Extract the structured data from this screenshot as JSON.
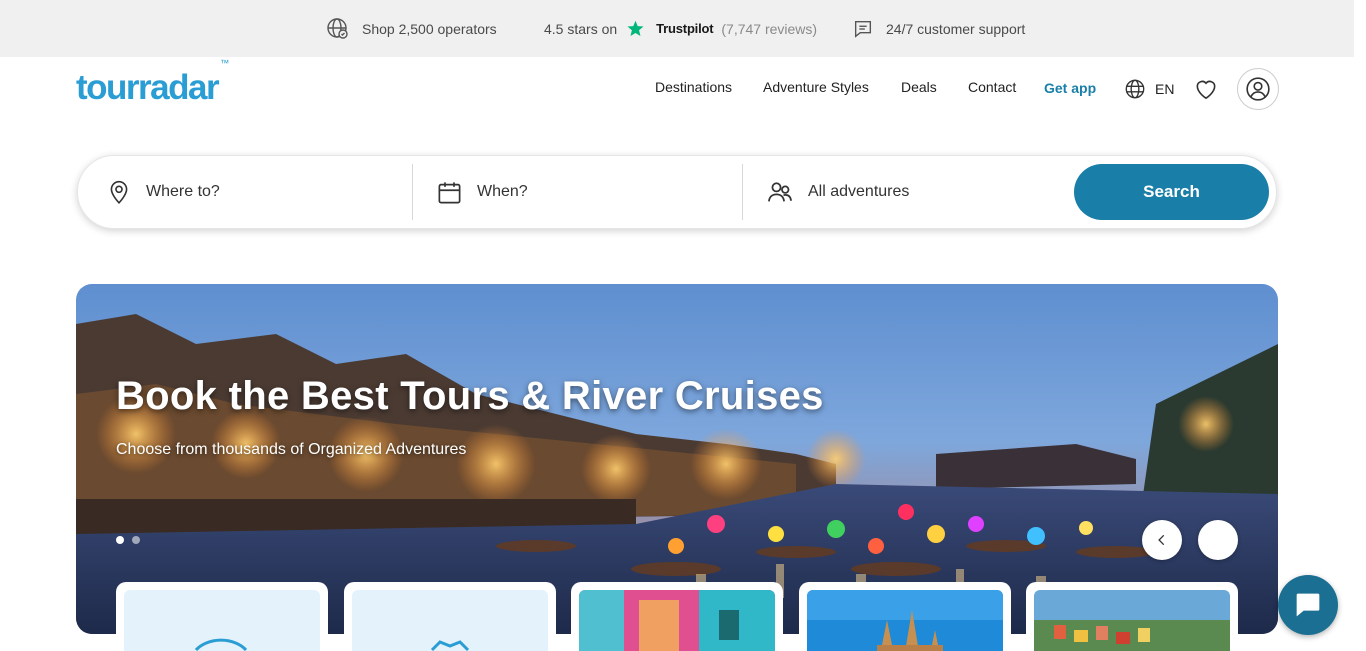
{
  "topbar": {
    "operators": "Shop 2,500 operators",
    "rating_prefix": "4.5 stars on",
    "trustpilot": "Trustpilot",
    "reviews": "(7,747 reviews)",
    "support": "24/7 customer support"
  },
  "header": {
    "logo": "tourradar",
    "logo_tm": "™",
    "nav": [
      "Destinations",
      "Adventure Styles",
      "Deals",
      "Contact"
    ],
    "get_app": "Get app",
    "language": "EN"
  },
  "search": {
    "where_placeholder": "Where to?",
    "when_placeholder": "When?",
    "adventure_value": "All adventures",
    "button": "Search"
  },
  "hero": {
    "title": "Book the Best Tours & River Cruises",
    "subtitle": "Choose from thousands of Organized Adventures",
    "active_slide": 1,
    "total_slides": 2
  },
  "icons": {
    "operators": "globe-badge-icon",
    "rating": "trustpilot-star-icon",
    "support": "chat-bubble-icon",
    "language": "globe-icon",
    "wishlist": "heart-icon",
    "account": "user-icon",
    "where": "location-pin-icon",
    "when": "calendar-icon",
    "adventures": "people-icon",
    "prev": "chevron-left-icon",
    "next": "chevron-right-icon",
    "chat": "chat-icon"
  },
  "colors": {
    "brand": "#2a9dd4",
    "primary": "#1a7fa8",
    "trustpilot": "#00b67a",
    "topbar_bg": "#f0f0f0"
  }
}
